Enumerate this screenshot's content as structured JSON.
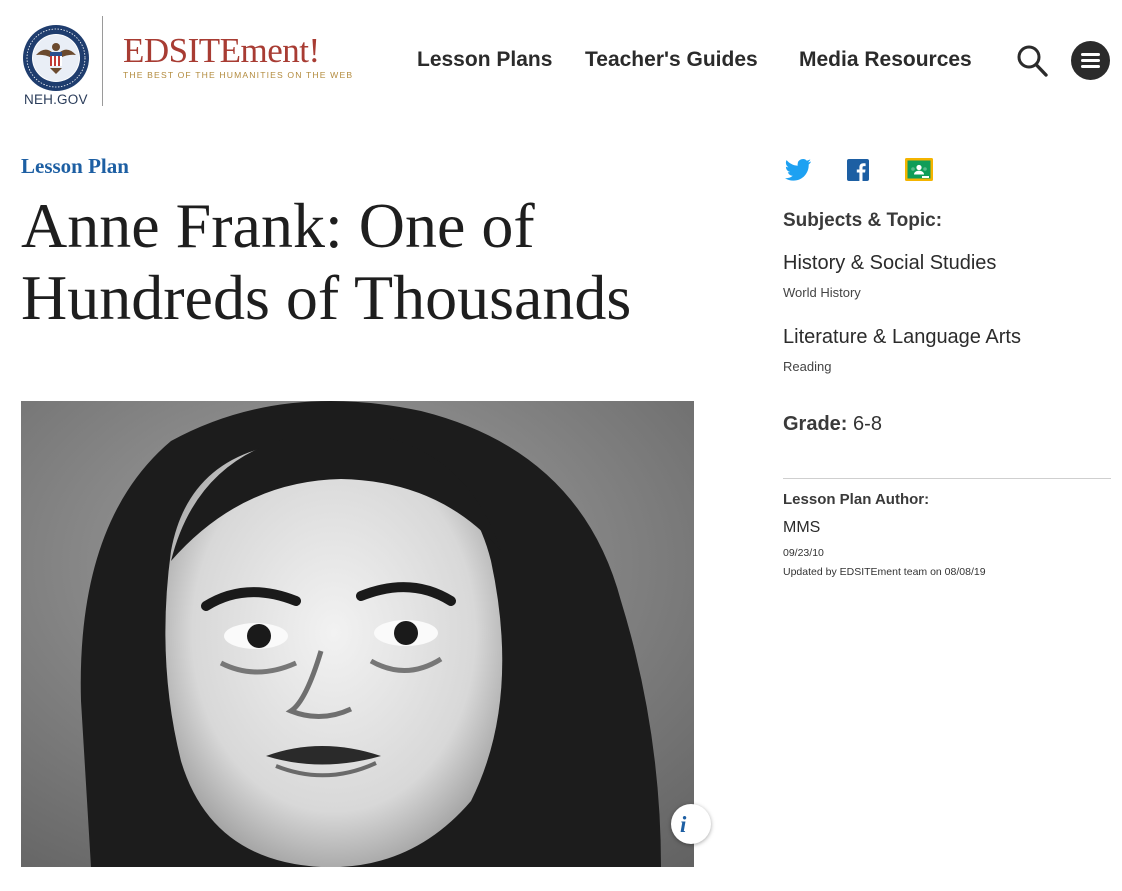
{
  "header": {
    "neh_label": "NEH.GOV",
    "brand_name": "EDSITEment!",
    "brand_tagline": "THE BEST OF THE HUMANITIES ON THE WEB",
    "nav": [
      "Lesson Plans",
      "Teacher's Guides",
      "Media Resources"
    ],
    "icons": [
      "search-icon",
      "menu-icon"
    ],
    "colors": {
      "brand_red": "#a83c33",
      "brand_gold": "#b38b3e",
      "dark": "#2b2b2b"
    }
  },
  "main": {
    "eyebrow": "Lesson Plan",
    "title": "Anne Frank: One of Hundreds of Thousands",
    "info_glyph": "i",
    "accent_color": "#1d5fa3"
  },
  "sidebar": {
    "share_icons": [
      "twitter-icon",
      "facebook-icon",
      "google-classroom-icon"
    ],
    "subjects_heading": "Subjects & Topic:",
    "subjects": [
      {
        "name": "History & Social Studies",
        "topic": "World History"
      },
      {
        "name": "Literature & Language Arts",
        "topic": "Reading"
      }
    ],
    "grade_label": "Grade:",
    "grade_value": "6-8",
    "author_heading": "Lesson Plan Author:",
    "author": "MMS",
    "date": "09/23/10",
    "updated": "Updated by EDSITEment team on 08/08/19"
  }
}
